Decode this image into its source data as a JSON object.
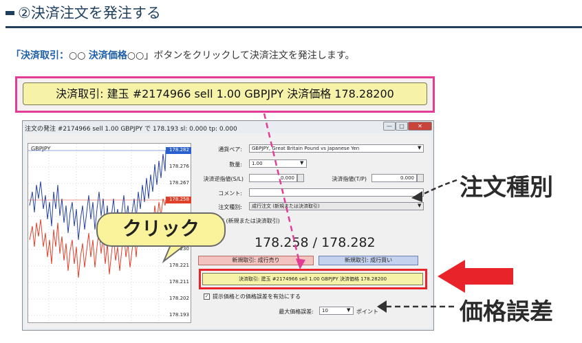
{
  "heading": {
    "title": "②決済注文を発注する"
  },
  "intro": {
    "open_bracket": "「",
    "bold1": "決済取引：",
    "mid1": "○○ ",
    "bold2": "決済価格",
    "mid2": "○○」",
    "rest": "ボタンをクリックして決済注文を発注します。"
  },
  "callout_button": {
    "label": "決済取引: 建玉 #2174966 sell 1.00 GBPJPY 決済価格 178.28200"
  },
  "window": {
    "title": "注文の発注 #2174966 sell 1.00 GBPJPY で 178.193 sl: 0.000 tp: 0.000",
    "min_label": "—",
    "max_label": "□",
    "close_label": "✕"
  },
  "chart": {
    "symbol": "GBPJPY",
    "ticks": [
      "178.282",
      "178.276",
      "178.267",
      "178.258",
      "178.249",
      "178.240",
      "178.230",
      "178.221",
      "178.211",
      "178.202",
      "178.193"
    ],
    "ask_tick_index": 0,
    "bid_tick_index": 3,
    "colors": {
      "ask": "#2340a0",
      "bid": "#e0402a",
      "ask_box": "#2a5fd0",
      "bid_box": "#e0402a"
    }
  },
  "form": {
    "symbol_label": "通貨ペア:",
    "symbol_value": "GBPJPY, Great Britain Pound vs Japanese Yen",
    "volume_label": "数量:",
    "volume_value": "1.00",
    "sl_label": "決済逆指値(S/L)",
    "sl_value": "0.000",
    "tp_label": "決済指値(T/P)",
    "tp_value": "0.000",
    "comment_label": "コメント:",
    "comment_value": "",
    "type_label": "注文種別:",
    "type_value": "成行注文 (新規または決済取引)",
    "section_label": "文 (新規または決済取引)",
    "bid_price": "178.258",
    "separator": " / ",
    "ask_price": "178.282",
    "sell_label": "新規取引: 成行売り",
    "buy_label": "新規取引: 成行買い",
    "close_button_label": "決済取引: 建玉 #2174966 sell 1.00 GBPJPY 決済価格 178.28200",
    "deviation_check_label": "提示価格との価格誤差を有効にする",
    "deviation_checked": true,
    "check_mark": "✓",
    "max_deviation_label": "最大価格誤差:",
    "max_deviation_value": "10",
    "points_label": "ポイント",
    "dropdown_arrow": "▼"
  },
  "annotations": {
    "click": "クリック",
    "order_type": "注文種別",
    "price_error": "価格誤差"
  },
  "colors": {
    "heading": "#1f3f5f",
    "pink": "#e23c96",
    "red": "#e8242a",
    "yellow": "#f6f3a8"
  }
}
